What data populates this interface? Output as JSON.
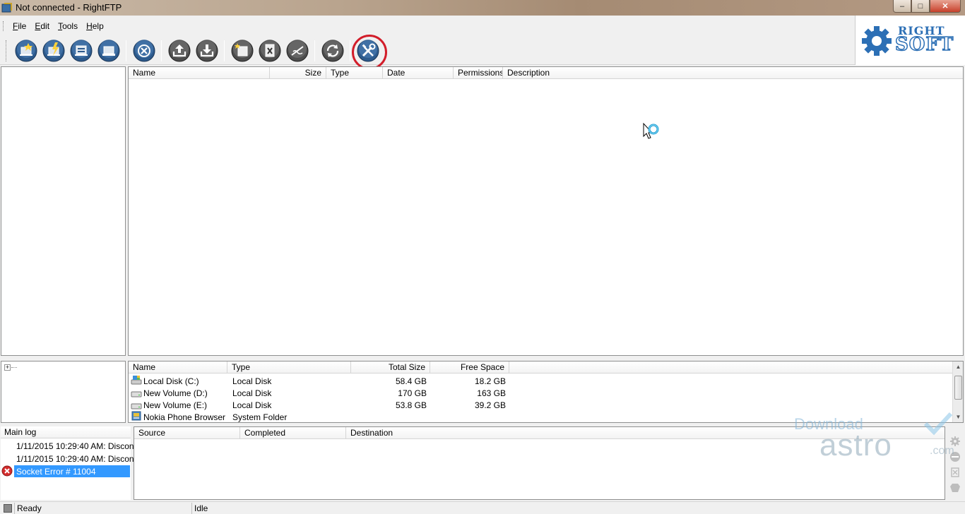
{
  "window": {
    "title": "Not connected - RightFTP",
    "controls": {
      "minimize": "–",
      "maximize": "□",
      "close": "✕"
    }
  },
  "menu": {
    "items": [
      {
        "mnemonic": "F",
        "rest": "ile"
      },
      {
        "mnemonic": "E",
        "rest": "dit"
      },
      {
        "mnemonic": "T",
        "rest": "ools"
      },
      {
        "mnemonic": "H",
        "rest": "elp"
      }
    ]
  },
  "toolbar": {
    "buttons": [
      {
        "icon": "new-connection-icon"
      },
      {
        "icon": "quick-connect-icon"
      },
      {
        "icon": "site-manager-icon"
      },
      {
        "icon": "disconnect-monitor-icon"
      },
      {
        "icon": "stop-icon"
      },
      {
        "icon": "upload-icon"
      },
      {
        "icon": "download-icon"
      },
      {
        "icon": "new-folder-icon"
      },
      {
        "icon": "delete-icon"
      },
      {
        "icon": "rename-icon"
      },
      {
        "icon": "refresh-icon"
      },
      {
        "icon": "settings-tools-icon",
        "highlighted": true
      }
    ]
  },
  "logo": {
    "line1": "RIGHT",
    "line2": "SOFT",
    "color": "#2c6fb5"
  },
  "remote_list": {
    "columns": [
      "Name",
      "Size",
      "Type",
      "Date",
      "Permissions",
      "Description"
    ]
  },
  "local_tree": {
    "expander": "+"
  },
  "local_list": {
    "columns": [
      "Name",
      "Type",
      "Total Size",
      "Free Space"
    ],
    "rows": [
      {
        "name": "Local Disk (C:)",
        "type": "Local Disk",
        "total": "58.4 GB",
        "free": "18.2 GB",
        "icon": "system-drive-icon"
      },
      {
        "name": "New Volume (D:)",
        "type": "Local Disk",
        "total": "170 GB",
        "free": "163 GB",
        "icon": "drive-icon"
      },
      {
        "name": "New Volume (E:)",
        "type": "Local Disk",
        "total": "53.8 GB",
        "free": "39.2 GB",
        "icon": "drive-icon"
      },
      {
        "name": "Nokia Phone Browser",
        "type": "System Folder",
        "total": "",
        "free": "",
        "icon": "phone-browser-icon"
      }
    ]
  },
  "log": {
    "header": "Main log",
    "entries": [
      {
        "text": "1/11/2015 10:29:40 AM: Disconn",
        "error": false
      },
      {
        "text": "1/11/2015 10:29:40 AM: Disconn",
        "error": false
      },
      {
        "text": "Socket Error # 11004",
        "error": true
      }
    ]
  },
  "queue": {
    "columns": [
      "Source",
      "Completed",
      "Destination"
    ]
  },
  "status": {
    "left": "Ready",
    "right": "Idle"
  },
  "watermark": {
    "line1": "Download",
    "line2": "astro",
    "suffix": ".com"
  },
  "colors": {
    "selection": "#3399ff",
    "highlight_ring": "#d21d2a",
    "toolbar_button": "#2d5a8c"
  }
}
